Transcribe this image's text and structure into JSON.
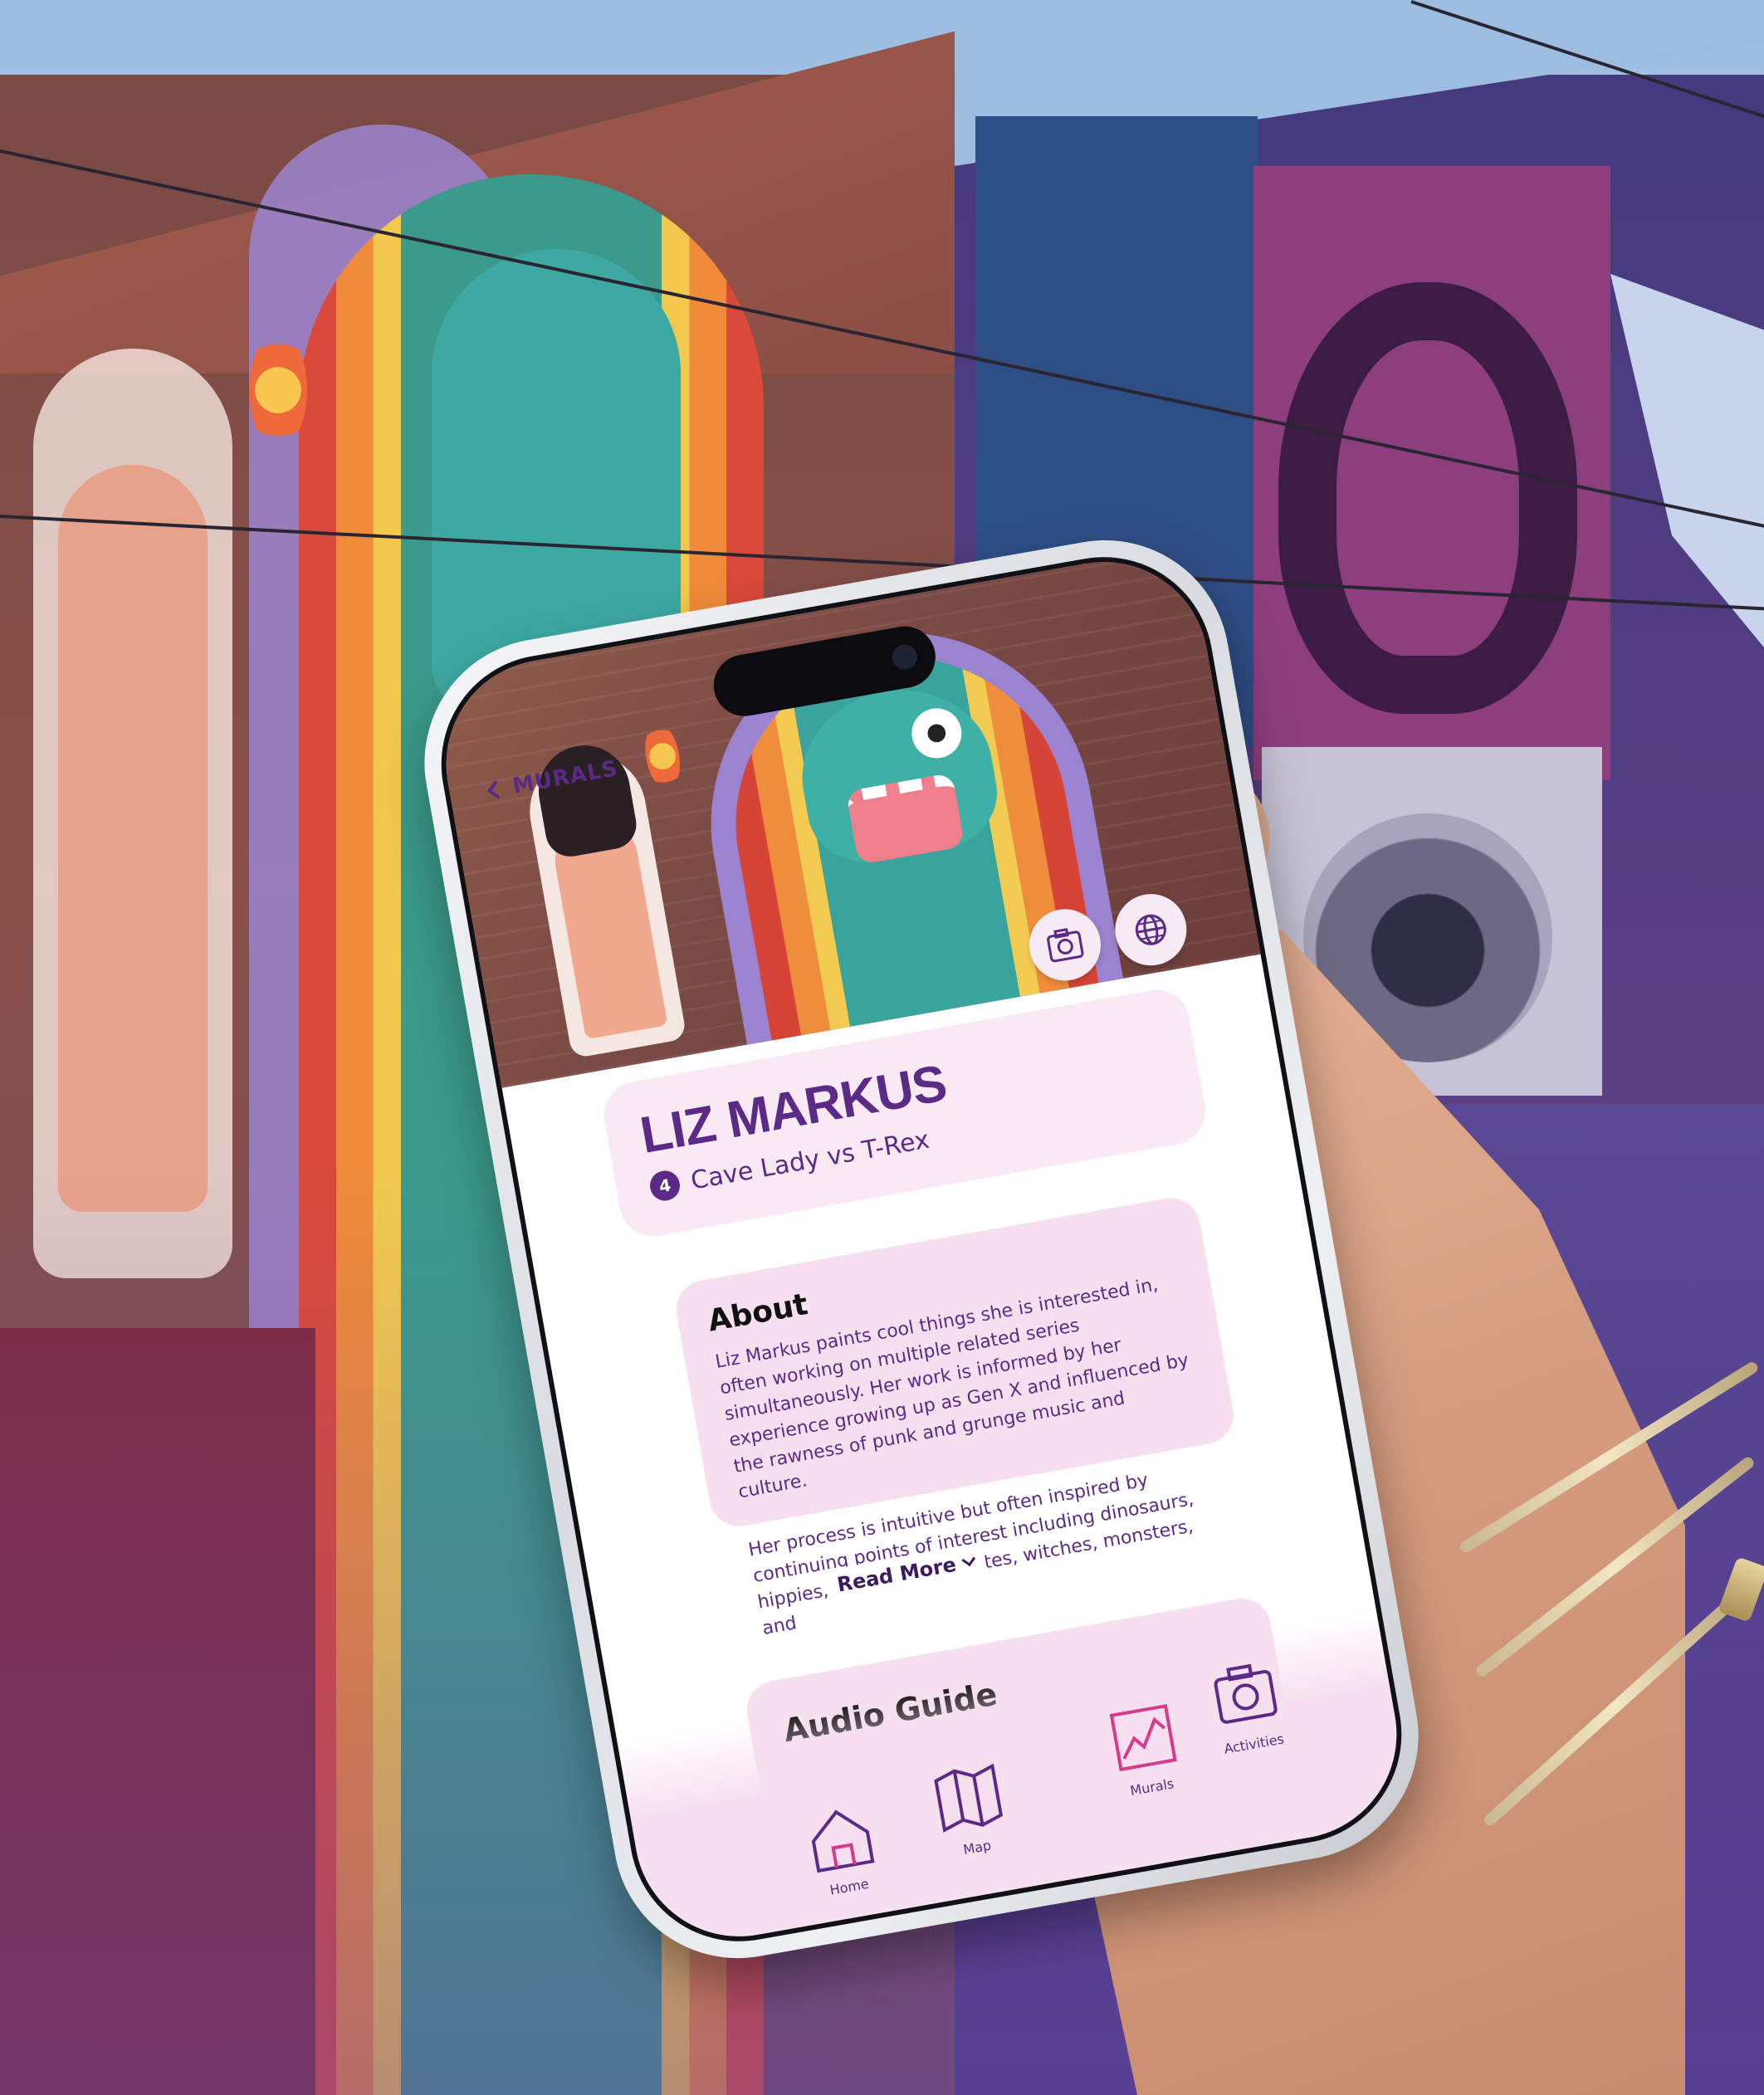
{
  "nav": {
    "back_label": "MURALS"
  },
  "artist": {
    "name": "LIZ MARKUS",
    "mural_number": "4",
    "mural_title": "Cave Lady vs T-Rex"
  },
  "hero_actions": {
    "camera_icon": "camera-icon",
    "globe_icon": "globe-icon"
  },
  "about": {
    "title": "About",
    "paragraph_1": "Liz Markus paints cool things she is interested in, often working on multiple related series simultaneously. Her work is informed by her experience growing up as Gen X and influenced by the rawness of punk and grunge music and culture.",
    "paragraph_2": "Her process is intuitive but often inspired by continuing points of interest including dinosaurs, hippies, cavemen, socialites, witches, monsters, and",
    "read_more": "Read More"
  },
  "audio_guide": {
    "title": "Audio Guide"
  },
  "tabbar": {
    "items": [
      {
        "label": "Home",
        "icon": "home-icon"
      },
      {
        "label": "Map",
        "icon": "map-icon"
      },
      {
        "label": "Murals",
        "icon": "murals-icon"
      },
      {
        "label": "Activities",
        "icon": "activities-icon"
      }
    ]
  },
  "colors": {
    "brand_purple": "#5b2a86",
    "card_pink": "#f9e9f5",
    "accent_magenta": "#d63a8a"
  }
}
